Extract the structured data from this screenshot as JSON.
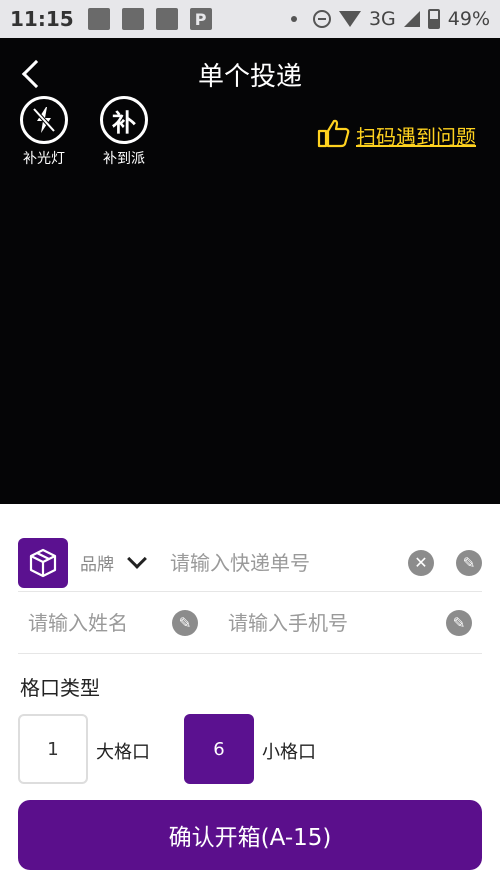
{
  "status_bar": {
    "time": "11:15",
    "app_badge": "P",
    "network": "3G",
    "battery": "49%"
  },
  "header": {
    "title": "单个投递"
  },
  "tools": {
    "flashlight_label": "补光灯",
    "supplement_glyph": "补",
    "supplement_label": "补到派"
  },
  "help_link": {
    "label": "扫码遇到问题"
  },
  "form": {
    "brand_label": "品牌",
    "tracking_placeholder": "请输入快递单号",
    "name_placeholder": "请输入姓名",
    "phone_placeholder": "请输入手机号",
    "slot_type_label": "格口类型",
    "large_slot_count": "1",
    "large_slot_label": "大格口",
    "small_slot_count": "6",
    "small_slot_label": "小格口"
  },
  "confirm_button": {
    "label": "确认开箱(A-15)"
  },
  "colors": {
    "accent": "#5b1190",
    "help_link": "#ffd21f",
    "camera_bg": "#050506"
  }
}
